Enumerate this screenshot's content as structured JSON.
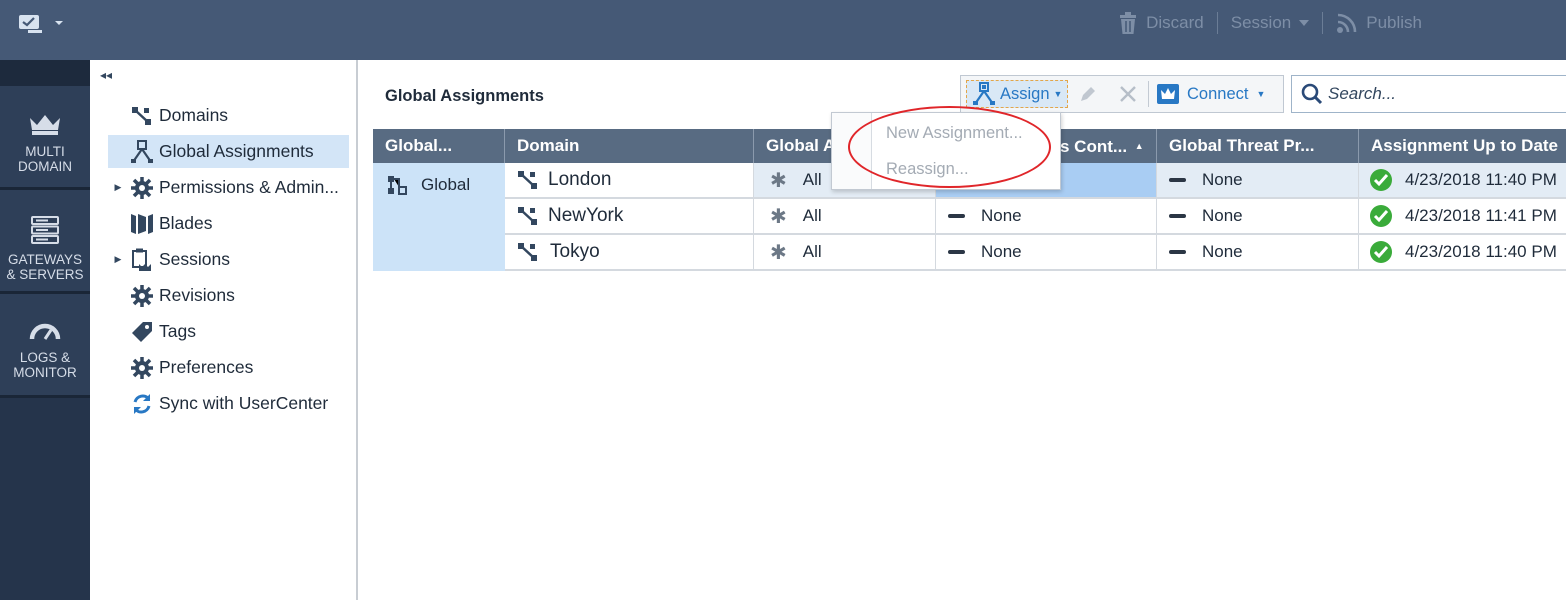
{
  "topbar": {
    "discard": "Discard",
    "session": "Session",
    "publish": "Publish"
  },
  "rail": {
    "items": [
      {
        "line1": "MULTI",
        "line2": "DOMAIN"
      },
      {
        "line1": "GATEWAYS",
        "line2": "& SERVERS"
      },
      {
        "line1": "LOGS &",
        "line2": "MONITOR"
      }
    ]
  },
  "nav": {
    "items": [
      {
        "label": "Domains",
        "icon": "domains-icon"
      },
      {
        "label": "Global Assignments",
        "icon": "global-assignments-icon"
      },
      {
        "label": "Permissions & Admin...",
        "icon": "gear-icon"
      },
      {
        "label": "Blades",
        "icon": "blades-icon"
      },
      {
        "label": "Sessions",
        "icon": "sessions-icon"
      },
      {
        "label": "Revisions",
        "icon": "gear-icon"
      },
      {
        "label": "Tags",
        "icon": "tag-icon"
      },
      {
        "label": "Preferences",
        "icon": "gear-icon"
      },
      {
        "label": "Sync with UserCenter",
        "icon": "sync-icon"
      }
    ]
  },
  "main": {
    "title": "Global Assignments",
    "toolbar": {
      "assign": "Assign",
      "connect": "Connect"
    },
    "search": {
      "placeholder": "Search..."
    }
  },
  "table": {
    "columns": [
      "Global...",
      "Domain",
      "Global Ac",
      "s Cont...",
      "Global Threat Pr...",
      "Assignment Up to Date"
    ],
    "global_label": "Global",
    "rows": [
      {
        "domain": "London",
        "access": "All",
        "threat_cont": "",
        "threat_prev": "None",
        "date": "4/23/2018 11:40 PM"
      },
      {
        "domain": "NewYork",
        "access": "All",
        "threat_cont": "None",
        "threat_prev": "None",
        "date": "4/23/2018 11:41 PM"
      },
      {
        "domain": "Tokyo",
        "access": "All",
        "threat_cont": "None",
        "threat_prev": "None",
        "date": "4/23/2018 11:40 PM"
      }
    ]
  },
  "dropdown": {
    "items": [
      "New Assignment...",
      "Reassign..."
    ]
  },
  "colors": {
    "topbar": "#455976",
    "rail": "#25344b",
    "accent": "#2878c4",
    "header": "#586b82",
    "selected": "#d3e5f7",
    "annotation": "#e0262a",
    "check": "#3aab3a"
  }
}
